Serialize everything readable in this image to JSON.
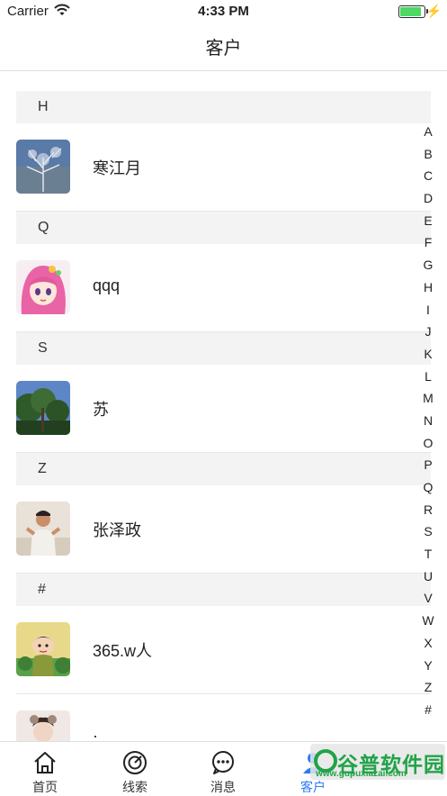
{
  "status_bar": {
    "carrier": "Carrier",
    "time": "4:33 PM"
  },
  "nav": {
    "title": "客户"
  },
  "sections": [
    {
      "header": "H",
      "contacts": [
        {
          "name": "寒江月",
          "avatar": "avatar-tree-photo"
        }
      ]
    },
    {
      "header": "Q",
      "contacts": [
        {
          "name": "qqq",
          "avatar": "avatar-anime-girl"
        }
      ]
    },
    {
      "header": "S",
      "contacts": [
        {
          "name": "苏",
          "avatar": "avatar-tree-sky"
        }
      ]
    },
    {
      "header": "Z",
      "contacts": [
        {
          "name": "张泽政",
          "avatar": "avatar-person-photo"
        }
      ]
    },
    {
      "header": "#",
      "contacts": [
        {
          "name": "365.w人",
          "avatar": "avatar-cartoon-character"
        },
        {
          "name": "·",
          "avatar": "avatar-child-photo"
        }
      ]
    }
  ],
  "index": [
    "A",
    "B",
    "C",
    "D",
    "E",
    "F",
    "G",
    "H",
    "I",
    "J",
    "K",
    "L",
    "M",
    "N",
    "O",
    "P",
    "Q",
    "R",
    "S",
    "T",
    "U",
    "V",
    "W",
    "X",
    "Y",
    "Z",
    "#"
  ],
  "tabs": [
    {
      "label": "首页",
      "icon": "home-icon"
    },
    {
      "label": "线索",
      "icon": "target-icon"
    },
    {
      "label": "消息",
      "icon": "chat-bubble-icon"
    },
    {
      "label": "客户",
      "icon": "person-icon"
    }
  ],
  "watermark": {
    "text": "谷普软件园",
    "url": "www.gupuxiazai.com"
  },
  "colors": {
    "accent": "#2d7cf6",
    "section_bg": "#f3f3f3",
    "battery": "#4cd964",
    "watermark": "#21a348"
  }
}
